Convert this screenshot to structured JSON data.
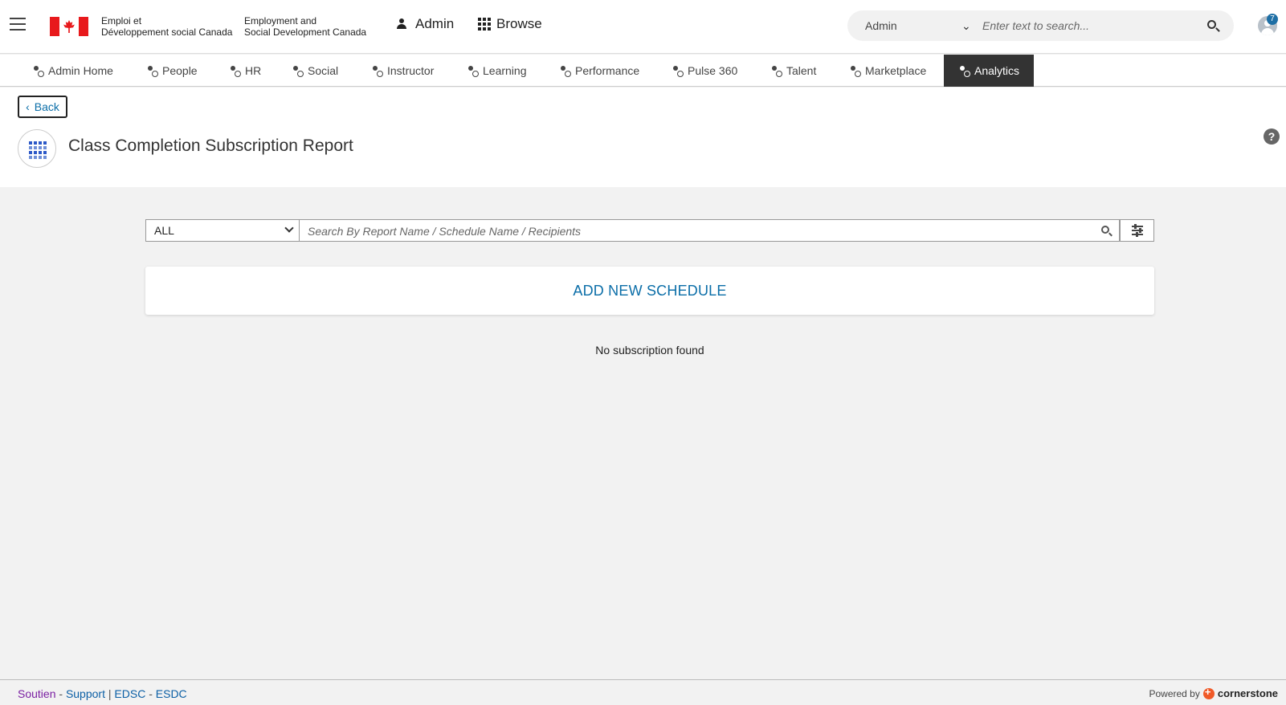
{
  "header": {
    "org_fr_line1": "Emploi et",
    "org_fr_line2": "Développement social Canada",
    "org_en_line1": "Employment and",
    "org_en_line2": "Social Development Canada",
    "admin_label": "Admin",
    "browse_label": "Browse",
    "search_scope": "Admin",
    "search_placeholder": "Enter text to search...",
    "notification_count": "7"
  },
  "nav": {
    "tabs": [
      {
        "label": "Admin Home",
        "icon": "admin-home-icon"
      },
      {
        "label": "People",
        "icon": "people-icon"
      },
      {
        "label": "HR",
        "icon": "hr-icon"
      },
      {
        "label": "Social",
        "icon": "social-icon"
      },
      {
        "label": "Instructor",
        "icon": "instructor-icon"
      },
      {
        "label": "Learning",
        "icon": "learning-icon"
      },
      {
        "label": "Performance",
        "icon": "performance-icon"
      },
      {
        "label": "Pulse 360",
        "icon": "pulse-icon"
      },
      {
        "label": "Talent",
        "icon": "talent-icon"
      },
      {
        "label": "Marketplace",
        "icon": "marketplace-icon"
      },
      {
        "label": "Analytics",
        "icon": "analytics-icon",
        "active": true
      }
    ]
  },
  "page": {
    "back_label": "Back",
    "title": "Class Completion Subscription Report",
    "help_symbol": "?"
  },
  "filters": {
    "type_selected": "ALL",
    "search_placeholder": "Search By Report Name / Schedule Name / Recipients"
  },
  "main": {
    "add_schedule_label": "ADD NEW SCHEDULE",
    "empty_message": "No subscription found"
  },
  "footer": {
    "link_soutien": "Soutien",
    "sep1": " - ",
    "link_support": "Support",
    "sep2": " | ",
    "link_edsc": "EDSC",
    "sep3": " - ",
    "link_esdc": "ESDC",
    "powered_by": "Powered by",
    "brand": "cornerstone"
  },
  "colors": {
    "accent": "#0b6ea8",
    "active_tab_bg": "#333333",
    "flag_red": "#e8191c",
    "soutien_link": "#7a1fa2"
  }
}
